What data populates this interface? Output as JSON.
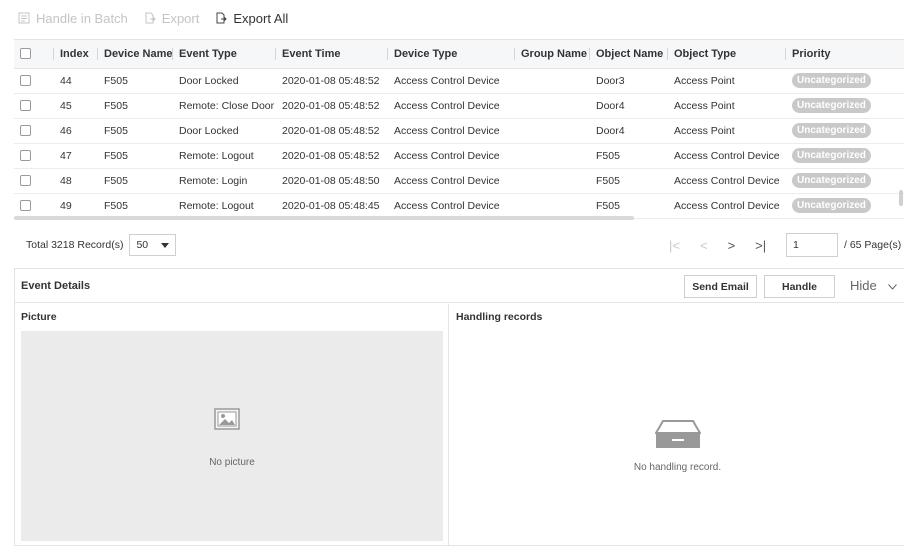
{
  "toolbar": {
    "handle_batch": "Handle in Batch",
    "export": "Export",
    "export_all": "Export All"
  },
  "table": {
    "headers": {
      "index": "Index",
      "device_name": "Device Name",
      "event_type": "Event Type",
      "event_time": "Event Time",
      "device_type": "Device Type",
      "group_name": "Group Name",
      "object_name": "Object Name",
      "object_type": "Object Type",
      "priority": "Priority"
    },
    "rows": [
      {
        "index": "44",
        "device_name": "F505",
        "event_type": "Door Locked",
        "event_time": "2020-01-08 05:48:52",
        "device_type": "Access Control Device",
        "group_name": "",
        "object_name": "Door3",
        "object_type": "Access Point",
        "priority": "Uncategorized"
      },
      {
        "index": "45",
        "device_name": "F505",
        "event_type": "Remote: Close Door",
        "event_time": "2020-01-08 05:48:52",
        "device_type": "Access Control Device",
        "group_name": "",
        "object_name": "Door4",
        "object_type": "Access Point",
        "priority": "Uncategorized"
      },
      {
        "index": "46",
        "device_name": "F505",
        "event_type": "Door Locked",
        "event_time": "2020-01-08 05:48:52",
        "device_type": "Access Control Device",
        "group_name": "",
        "object_name": "Door4",
        "object_type": "Access Point",
        "priority": "Uncategorized"
      },
      {
        "index": "47",
        "device_name": "F505",
        "event_type": "Remote: Logout",
        "event_time": "2020-01-08 05:48:52",
        "device_type": "Access Control Device",
        "group_name": "",
        "object_name": "F505",
        "object_type": "Access Control Device",
        "priority": "Uncategorized"
      },
      {
        "index": "48",
        "device_name": "F505",
        "event_type": "Remote: Login",
        "event_time": "2020-01-08 05:48:50",
        "device_type": "Access Control Device",
        "group_name": "",
        "object_name": "F505",
        "object_type": "Access Control Device",
        "priority": "Uncategorized"
      },
      {
        "index": "49",
        "device_name": "F505",
        "event_type": "Remote: Logout",
        "event_time": "2020-01-08 05:48:45",
        "device_type": "Access Control Device",
        "group_name": "",
        "object_name": "F505",
        "object_type": "Access Control Device",
        "priority": "Uncategorized"
      }
    ]
  },
  "pagination": {
    "total": "Total 3218 Record(s)",
    "page_size": "50",
    "current_page": "1",
    "total_pages": "/ 65 Page(s)"
  },
  "details": {
    "title": "Event Details",
    "send_email": "Send Email",
    "handle": "Handle",
    "hide": "Hide",
    "picture_title": "Picture",
    "no_picture": "No picture",
    "handling_title": "Handling records",
    "no_handling": "No handling record."
  },
  "colors": {
    "badge": "#c9c9c9",
    "header_bg": "#f6f7f9",
    "placeholder_bg": "#ebebeb"
  }
}
